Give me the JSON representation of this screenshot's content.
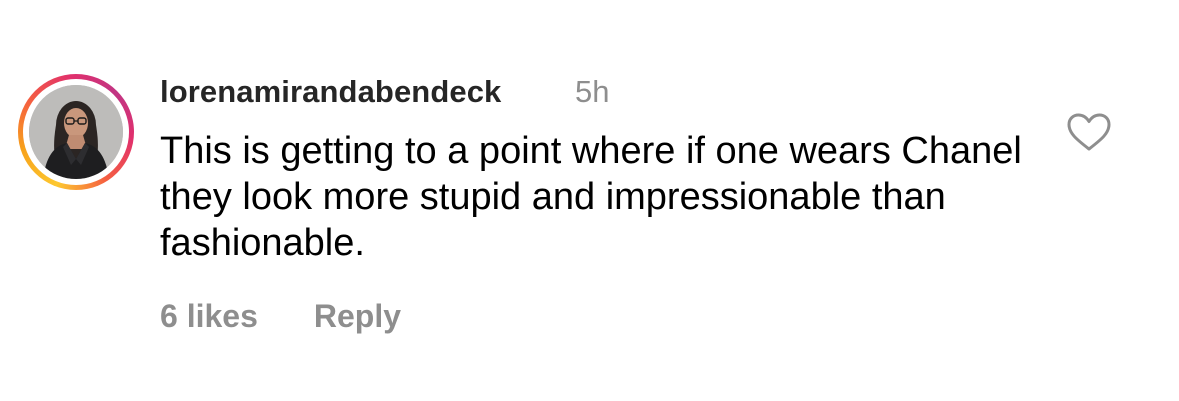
{
  "comment": {
    "username": "lorenamirandabendeck",
    "time_ago": "5h",
    "text": "This is getting to a point where if one wears Chanel they look more stupid and impressionable than fashionable.",
    "likes_label": "6 likes",
    "reply_label": "Reply",
    "like_icon": "heart-outline-icon"
  },
  "colors": {
    "username": "#262626",
    "secondary": "#8e8e8e",
    "story_ring": [
      "#fdc830",
      "#f56040",
      "#e1306c",
      "#c13584"
    ]
  }
}
